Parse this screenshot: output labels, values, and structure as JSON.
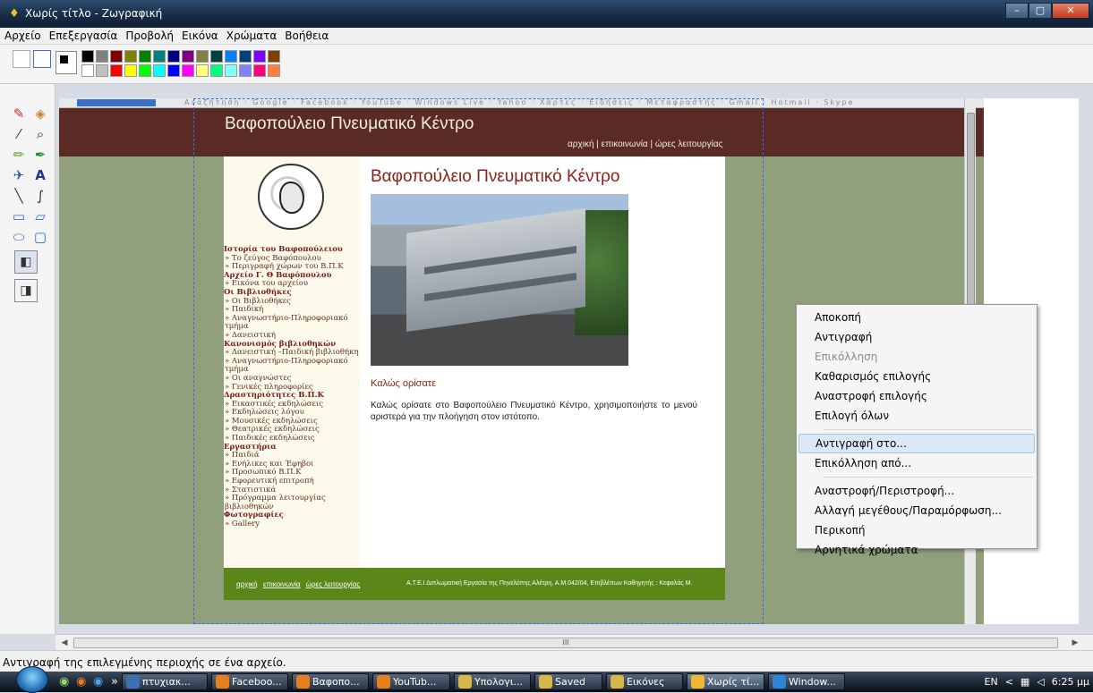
{
  "window": {
    "title": "Χωρίς τίτλο - Ζωγραφική",
    "controls": [
      "–",
      "▢",
      "✕"
    ]
  },
  "menu": {
    "items": [
      "Αρχείο",
      "Επεξεργασία",
      "Προβολή",
      "Εικόνα",
      "Χρώματα",
      "Βοήθεια"
    ]
  },
  "palette": {
    "colors": [
      "#000000",
      "#808080",
      "#800000",
      "#808000",
      "#008000",
      "#008080",
      "#000080",
      "#800080",
      "#808040",
      "#004040",
      "#0080ff",
      "#004080",
      "#8000ff",
      "#804000",
      "#ffffff",
      "#c0c0c0",
      "#ff0000",
      "#ffff00",
      "#00ff00",
      "#00ffff",
      "#0000ff",
      "#ff00ff",
      "#ffff80",
      "#00ff80",
      "#80ffff",
      "#8080ff",
      "#ff0080",
      "#ff8040"
    ]
  },
  "website": {
    "strip_text": "Αναζήτηση · Google · Facebook · YouTube · Windows Live · Yahoo · Χάρτες · Ειδήσεις · Μεταφραστής · Gmail · Hotmail · Skype",
    "site_title": "Βαφοπούλειο Πνευματικό Κέντρο",
    "top_links": "αρχική | επικοινωνία | ώρες λειτουργίας",
    "main_title": "Βαφοπούλειο Πνευματικό Κέντρο",
    "welcome_head": "Καλώς ορίσατε",
    "welcome_text": "Καλώς ορίσατε στο Βαφοπούλειο Πνευματικό Κέντρο, χρησιμοποιήστε το μενού αριστερά για την πλοήγηση στον ιστότοπο.",
    "footer_links": [
      "αρχική",
      "επικοινωνία",
      "ώρες λειτουργίας"
    ],
    "footer_credit": "Α.Τ.Ε.Ι Διπλωματική Εργασία της Πηνελόπης Αλέτρη, Α.Μ.042/04, Επιβλέπων Καθηγητής : Κεφαλάς Μ.",
    "side_links": [
      {
        "t": "Ιστορία του Βαφοπούλειου",
        "h": true
      },
      {
        "t": "» Το ζεύγος Βαφόπουλου",
        "h": false
      },
      {
        "t": "» Περιγραφή χώρων του Β.Π.Κ",
        "h": false
      },
      {
        "t": "Αρχείο Γ. Θ Βαφόπουλου",
        "h": true
      },
      {
        "t": "» Εικόνα του αρχείου",
        "h": false
      },
      {
        "t": "Οι Βιβλιοθήκες",
        "h": true
      },
      {
        "t": "» Οι Βιβλιοθήκες",
        "h": false
      },
      {
        "t": "» Παιδική",
        "h": false
      },
      {
        "t": "» Αναγνωστήριο-Πληροφοριακό τμήμα",
        "h": false
      },
      {
        "t": "» Δανειστική",
        "h": false
      },
      {
        "t": "Κανονισμός βιβλιοθηκών",
        "h": true
      },
      {
        "t": "» Δανειστική –Παιδική βιβλιοθήκη",
        "h": false
      },
      {
        "t": "» Αναγνωστήριο-Πληροφοριακό τμήμα",
        "h": false
      },
      {
        "t": "» Οι αναγνώστες",
        "h": false
      },
      {
        "t": "» Γενικές πληροφορίες",
        "h": false
      },
      {
        "t": "Δραστηριότητες Β.Π.Κ",
        "h": true
      },
      {
        "t": "» Εικαστικές εκδηλώσεις",
        "h": false
      },
      {
        "t": "» Εκδηλώσεις λόγου",
        "h": false
      },
      {
        "t": "» Μουσικές εκδηλώσεις",
        "h": false
      },
      {
        "t": "» Θεατρικές εκδηλώσεις",
        "h": false
      },
      {
        "t": "» Παιδικές εκδηλώσεις",
        "h": false
      },
      {
        "t": "Εργαστήρια",
        "h": true
      },
      {
        "t": "» Παιδιά",
        "h": false
      },
      {
        "t": "» Ενήλικες και Έφηβοι",
        "h": false
      },
      {
        "t": "» Προσωπικό Β.Π.Κ",
        "h": false
      },
      {
        "t": "» Εφορευτική επιτροπή",
        "h": false
      },
      {
        "t": "» Στατιστικά",
        "h": false
      },
      {
        "t": "» Πρόγραμμα λειτουργίας βιβλιοθηκών",
        "h": false
      },
      {
        "t": "Φωτογραφίες",
        "h": true
      },
      {
        "t": "» Gallery",
        "h": false
      }
    ]
  },
  "context_menu": {
    "groups": [
      [
        {
          "label": "Αποκοπή"
        },
        {
          "label": "Αντιγραφή"
        },
        {
          "label": "Επικόλληση",
          "disabled": true
        },
        {
          "label": "Καθαρισμός επιλογής"
        },
        {
          "label": "Αναστροφή επιλογής"
        },
        {
          "label": "Επιλογή όλων"
        }
      ],
      [
        {
          "label": "Αντιγραφή στο...",
          "hover": true
        },
        {
          "label": "Επικόλληση από..."
        }
      ],
      [
        {
          "label": "Αναστροφή/Περιστροφή..."
        },
        {
          "label": "Αλλαγή μεγέθους/Παραμόρφωση..."
        },
        {
          "label": "Περικοπή"
        },
        {
          "label": "Αρνητικά χρώματα"
        }
      ]
    ]
  },
  "hscroll": {
    "thumb_grip": "III"
  },
  "status": {
    "text": "Αντιγραφή της επιλεγμένης περιοχής σε ένα αρχείο."
  },
  "taskbar": {
    "tasks": [
      {
        "label": "πτυχιακ...",
        "color": "#3d6fb3"
      },
      {
        "label": "Faceboo...",
        "color": "#e57f1d"
      },
      {
        "label": "Βαφοπο...",
        "color": "#e57f1d"
      },
      {
        "label": "YouTub...",
        "color": "#e57f1d"
      },
      {
        "label": "Υπολογι...",
        "color": "#d8b74a"
      },
      {
        "label": "Saved",
        "color": "#d8b74a"
      },
      {
        "label": "Εικόνες",
        "color": "#d8b74a"
      },
      {
        "label": "Χωρίς τί...",
        "color": "#f0b830",
        "active": true
      },
      {
        "label": "Window...",
        "color": "#2f86d6"
      }
    ],
    "quick_launch_more": "»",
    "lang": "EN",
    "tray_more": "<",
    "clock": "6:25 μμ"
  }
}
